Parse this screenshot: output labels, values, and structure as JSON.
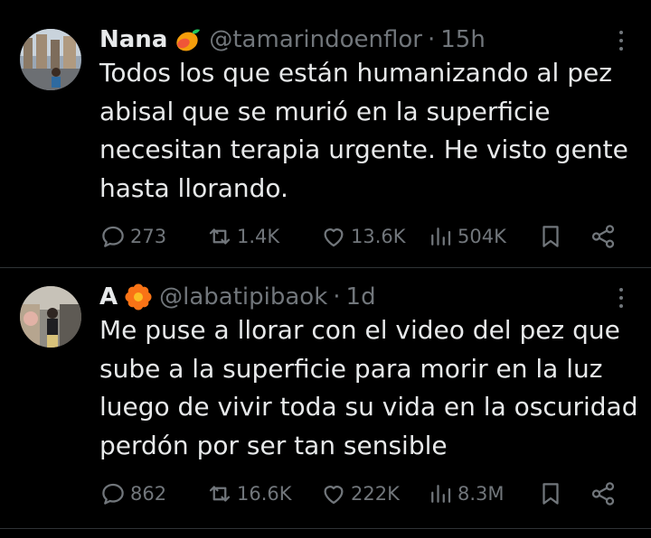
{
  "tweets": [
    {
      "name": "Nana",
      "emoji": "mango-icon",
      "handle": "@tamarindoenflor",
      "separator": "·",
      "time": "15h",
      "lines": [
        "Todos los que están humanizando al pez",
        "abisal que se murió en la superficie",
        "necesitan terapia urgente. He visto gente",
        "hasta llorando."
      ],
      "replies": "273",
      "retweets": "1.4K",
      "likes": "13.6K",
      "views": "504K"
    },
    {
      "name": "A",
      "emoji": "orange-flower-icon",
      "handle": "@labatipibaok",
      "separator": "·",
      "time": "1d",
      "lines": [
        "Me puse a llorar con el video del pez que",
        "sube a la superficie para morir en la luz",
        "luego de vivir toda su vida en la oscuridad",
        "perdón por ser tan sensible"
      ],
      "replies": "862",
      "retweets": "16.6K",
      "likes": "222K",
      "views": "8.3M"
    }
  ],
  "colors": {
    "background": "#000000",
    "text": "#e7e9ea",
    "muted": "#71767b",
    "divider": "#2f3336"
  }
}
